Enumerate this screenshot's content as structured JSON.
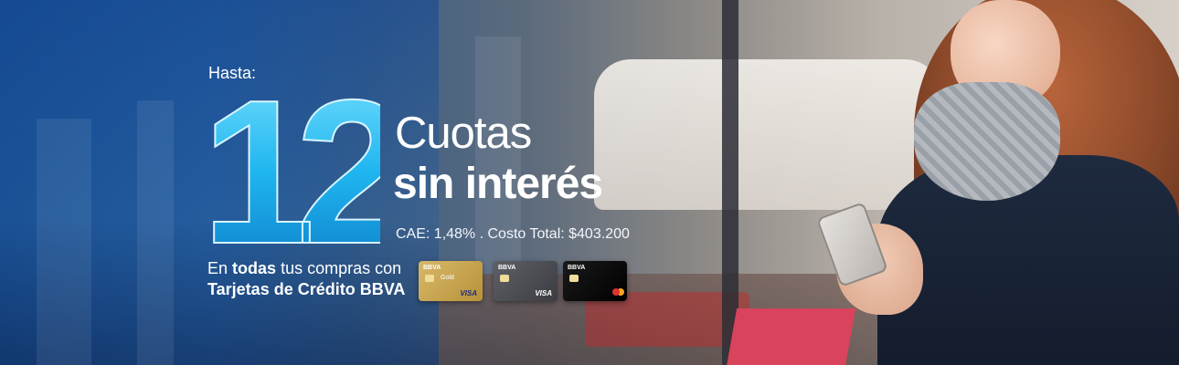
{
  "banner": {
    "intro": "Hasta:",
    "number": "12",
    "line1": "Cuotas",
    "line2": "sin interés",
    "cae": "CAE: 1,48% . Costo Total: $403.200",
    "en": "En",
    "todas": "todas",
    "rest": "tus compras con",
    "tarjetas": "Tarjetas de Crédito BBVA"
  },
  "cards": [
    {
      "bank": "BBVA",
      "kind": "Gold",
      "brand": "VISA"
    },
    {
      "bank": "BBVA",
      "kind": "",
      "brand": "VISA"
    },
    {
      "bank": "BBVA",
      "kind": "",
      "brand": ""
    }
  ],
  "colors": {
    "number_fill": "#1fb6f0",
    "text": "#ffffff"
  }
}
